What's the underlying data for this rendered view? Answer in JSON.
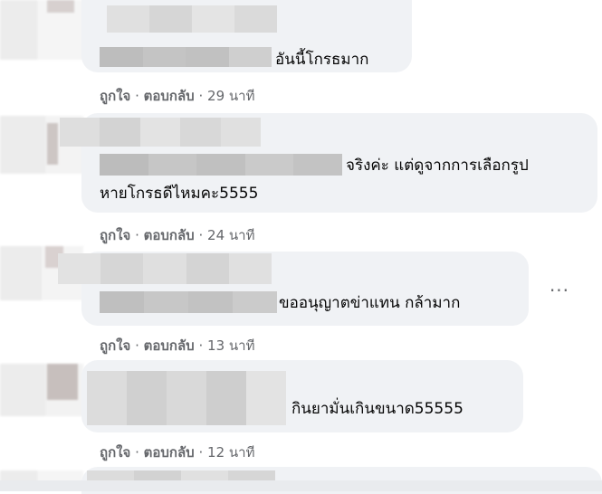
{
  "comments": [
    {
      "text": "อันนี้โกรธมาก",
      "like": "ถูกใจ",
      "reply": "ตอบกลับ",
      "time": "29 นาที",
      "separator": "·"
    },
    {
      "text_line1": "จริงค่ะ แต่ดูจากการเลือกรูป",
      "text_line2": "หายโกรธดีไหมคะ5555",
      "like": "ถูกใจ",
      "reply": "ตอบกลับ",
      "time": "24 นาที",
      "separator": "·"
    },
    {
      "text": "ขออนุญาตข่าแทน กล้ามาก",
      "like": "ถูกใจ",
      "reply": "ตอบกลับ",
      "time": "13 นาที",
      "separator": "·",
      "more": "···"
    },
    {
      "text": "กินยามั่นเกินขนาด55555",
      "like": "ถูกใจ",
      "reply": "ตอบกลับ",
      "time": "12 นาที",
      "separator": "·"
    }
  ],
  "icons": {
    "more": "more-options-icon"
  }
}
